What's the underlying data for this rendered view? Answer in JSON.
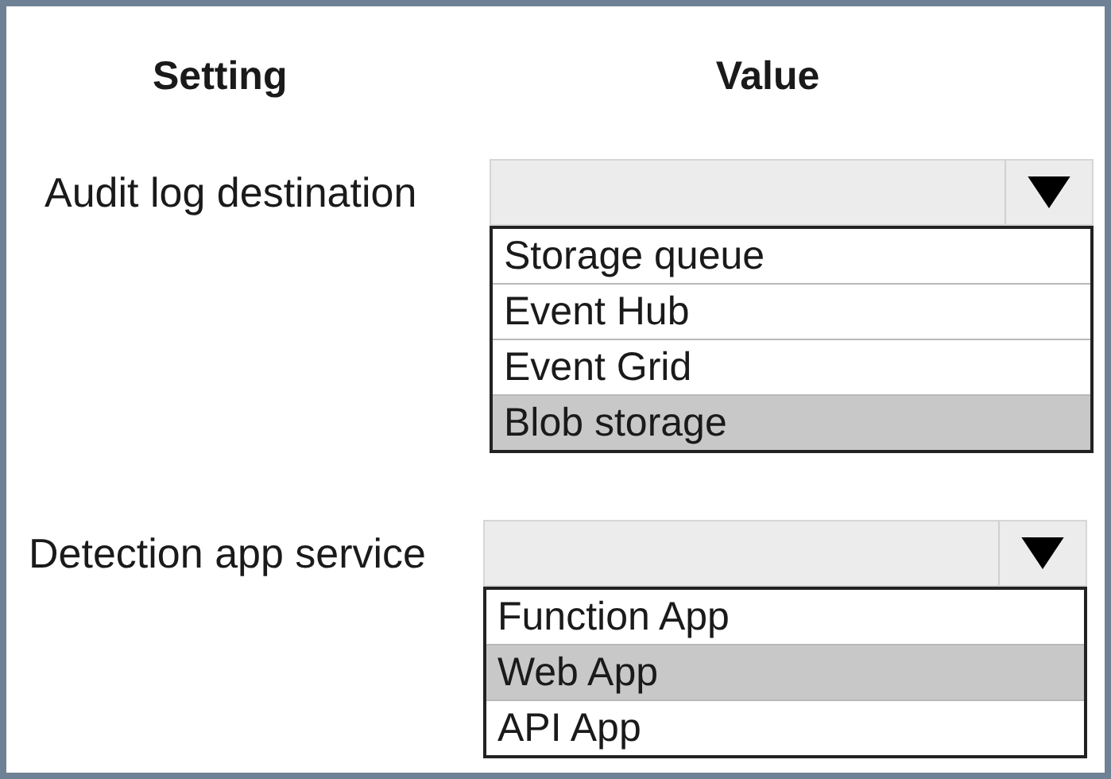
{
  "headers": [
    "Setting",
    "Value"
  ],
  "rows": [
    {
      "label": "Audit log destination",
      "options": [
        {
          "label": "Storage queue",
          "selected": false
        },
        {
          "label": "Event Hub",
          "selected": false
        },
        {
          "label": "Event Grid",
          "selected": false
        },
        {
          "label": "Blob storage",
          "selected": true
        }
      ]
    },
    {
      "label": "Detection app service",
      "options": [
        {
          "label": "Function App",
          "selected": false
        },
        {
          "label": "Web App",
          "selected": true
        },
        {
          "label": "API App",
          "selected": false
        }
      ]
    }
  ]
}
